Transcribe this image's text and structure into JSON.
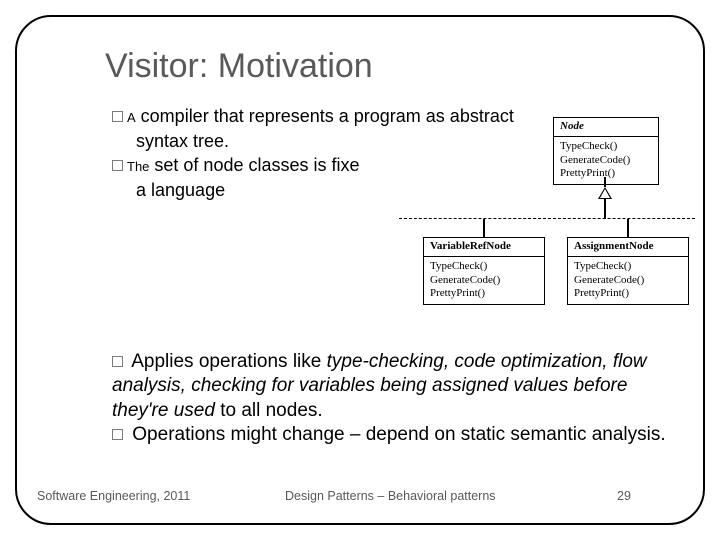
{
  "title": "Visitor: Motivation",
  "bullet1_a": "A",
  "bullet1_rest": " compiler that represents a program as abstract",
  "bullet1_line2": "syntax tree.",
  "bullet2_a": "The",
  "bullet2_rest": " set of node classes is fixe",
  "bullet2_line2": "a language",
  "uml": {
    "node": {
      "name": "Node",
      "ops": [
        "TypeCheck()",
        "GenerateCode()",
        "PrettyPrint()"
      ]
    },
    "varref": {
      "name": "VariableRefNode",
      "ops": [
        "TypeCheck()",
        "GenerateCode()",
        "PrettyPrint()"
      ]
    },
    "assign": {
      "name": "AssignmentNode",
      "ops": [
        "TypeCheck()",
        "GenerateCode()",
        "PrettyPrint()"
      ]
    }
  },
  "bullet3_lead": " Applies operations like ",
  "bullet3_italic": "type-checking, code optimization, flow analysis, checking for variables being assigned values before they're used",
  "bullet3_tail": " to all nodes.",
  "bullet4": " Operations might change – depend on static semantic analysis.",
  "footer": {
    "left": "Software Engineering, 2011",
    "mid": "Design Patterns – Behavioral patterns",
    "right": "29"
  }
}
